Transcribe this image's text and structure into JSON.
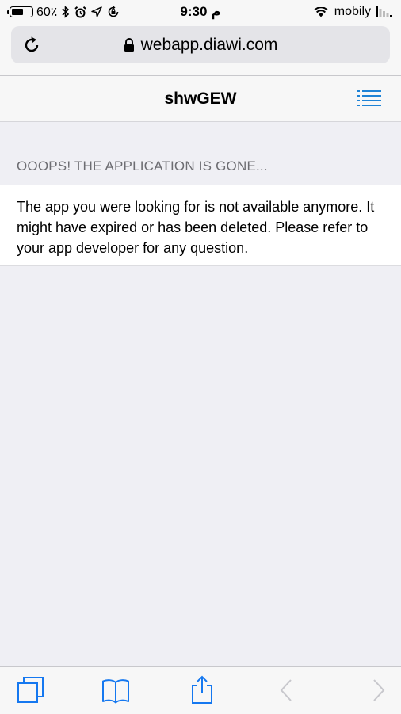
{
  "status_bar": {
    "battery_percent": "60٪",
    "battery_level": 0.6,
    "time": "9:30 م",
    "carrier": "mobily"
  },
  "browser": {
    "url": "webapp.diawi.com"
  },
  "page": {
    "title": "shwGEW",
    "section_header": "OOOPS! THE APPLICATION IS GONE...",
    "message": "The app you were looking for is not available anymore. It might have expired or has been deleted. Please refer to your app developer for any question."
  },
  "colors": {
    "accent": "#1e83d6",
    "toolbar_icon": "#1578f0",
    "disabled_icon": "#c7c7cc"
  },
  "icons": {
    "reload": "reload-icon",
    "lock": "lock-icon",
    "menu": "list-menu-icon",
    "tabs": "tabs-icon",
    "bookmarks": "bookmarks-icon",
    "share": "share-icon",
    "back": "back-chevron-icon",
    "forward": "forward-chevron-icon"
  }
}
